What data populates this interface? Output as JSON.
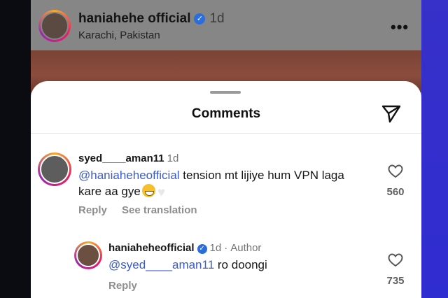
{
  "post": {
    "username": "haniahehe official",
    "time": "1d",
    "location": "Karachi, Pakistan",
    "more_icon": "more-horizontal-icon"
  },
  "sheet": {
    "title": "Comments",
    "share_icon": "paper-plane-icon"
  },
  "comments": [
    {
      "username": "syed____aman11",
      "time": "1d",
      "mention": "@haniaheheofficial",
      "text_line1": " tension mt lijiye hum VPN laga",
      "text_line2": "kare aa gye",
      "likes": "560",
      "reply_label": "Reply",
      "translate_label": "See translation"
    },
    {
      "username": "haniaheheofficial",
      "time": "1d",
      "author_label": "Author",
      "mention": "@syed____aman11",
      "text": " ro doongi",
      "likes": "735",
      "reply_label": "Reply"
    }
  ]
}
